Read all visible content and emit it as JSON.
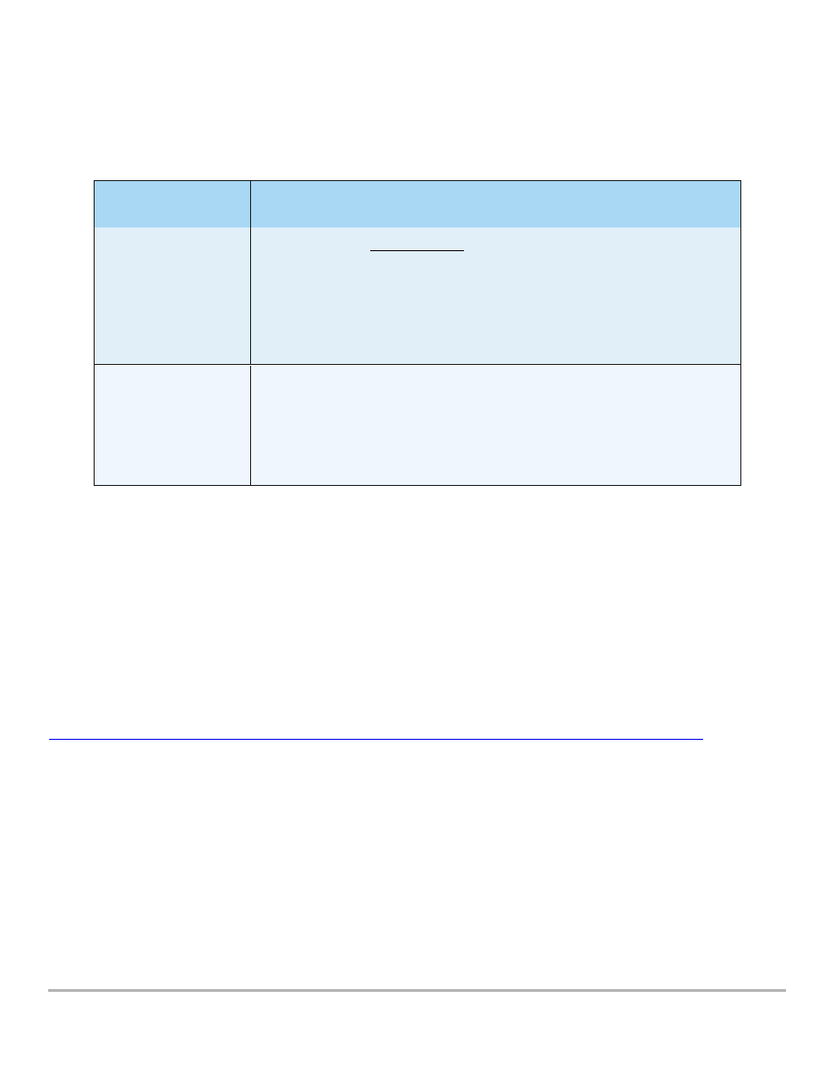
{
  "table": {
    "header": {
      "col1": "",
      "col2": ""
    },
    "rows": [
      {
        "col1": "",
        "col2": ""
      },
      {
        "col1": "",
        "col2": ""
      }
    ]
  },
  "link": {
    "text": ""
  },
  "colors": {
    "header_bg": "#a8d8f4",
    "row1_bg": "#e1eff9",
    "row2_bg": "#eff6fd",
    "link": "#0000ee",
    "footer_rule": "#b4b4b4"
  }
}
